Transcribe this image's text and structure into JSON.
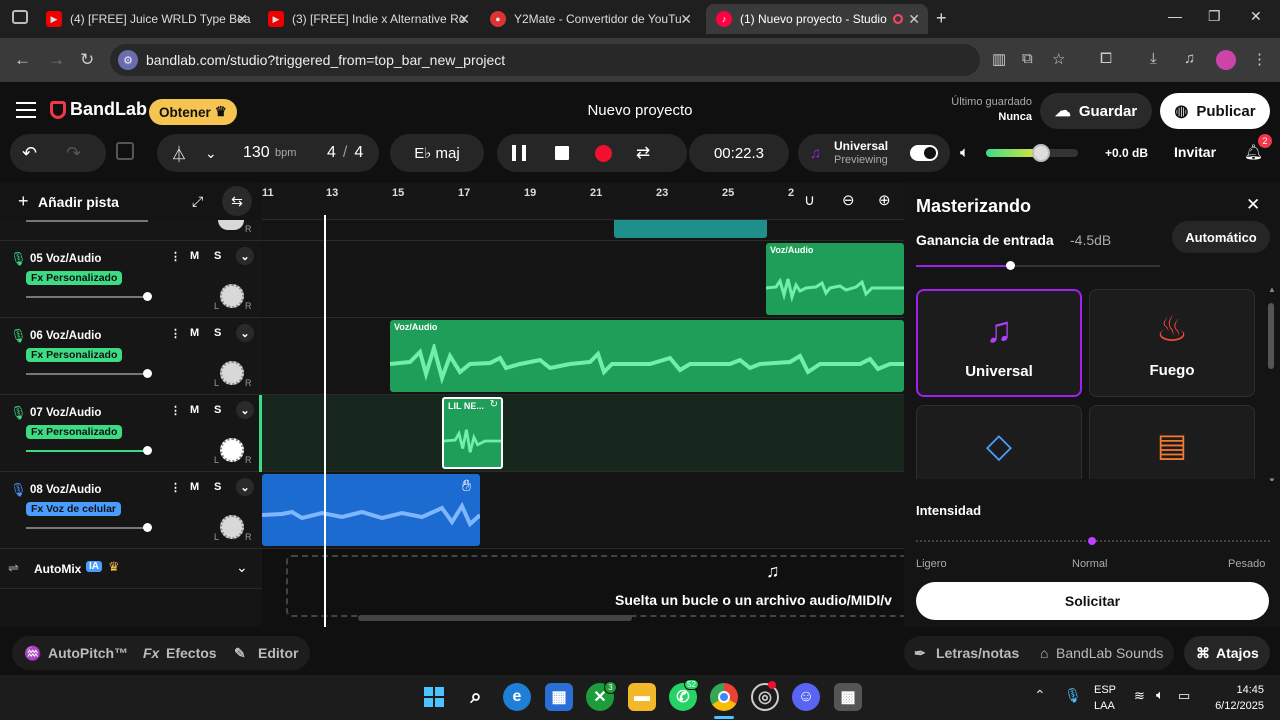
{
  "browser": {
    "tabs": [
      {
        "label": "(4) [FREE] Juice WRLD Type Bea",
        "close": "✕"
      },
      {
        "label": "(3) [FREE] Indie x Alternative Ro",
        "close": "✕"
      },
      {
        "label": "Y2Mate - Convertidor de YouTu",
        "close": "✕"
      },
      {
        "label": "(1) Nuevo proyecto - Studio",
        "close": "✕"
      }
    ],
    "new_tab": "+",
    "url": "bandlab.com/studio?triggered_from=top_bar_new_project"
  },
  "header": {
    "logo": "BandLab",
    "obtener": "Obtener",
    "project_title": "Nuevo proyecto",
    "last_saved_label": "Último guardado",
    "last_saved_value": "Nunca",
    "save": "Guardar",
    "publish": "Publicar"
  },
  "toolbar": {
    "bpm_value": "130",
    "bpm_unit": "bpm",
    "sig_num": "4",
    "sig_sep": "/",
    "sig_den": "4",
    "key": "E♭ maj",
    "time": "00:22.3",
    "universal_title": "Universal",
    "universal_sub": "Previewing",
    "db": "+0.0 dB",
    "invite": "Invitar",
    "notif_count": "2",
    "volume_fraction": 0.6
  },
  "tracks_panel": {
    "add_track": "Añadir pista",
    "ruler": [
      "11",
      "13",
      "15",
      "17",
      "19",
      "21",
      "23",
      "25",
      "2"
    ]
  },
  "tracks": [
    {
      "name": "05 Voz/Audio",
      "fx": "Fx Personalizado",
      "m": "M",
      "s": "S",
      "l": "L",
      "r": "R"
    },
    {
      "name": "06 Voz/Audio",
      "fx": "Fx Personalizado",
      "m": "M",
      "s": "S",
      "l": "L",
      "r": "R"
    },
    {
      "name": "07 Voz/Audio",
      "fx": "Fx Personalizado",
      "m": "M",
      "s": "S",
      "l": "L",
      "r": "R"
    },
    {
      "name": "08 Voz/Audio",
      "fx": "Fx Voz de celular",
      "m": "M",
      "s": "S",
      "l": "L",
      "r": "R"
    }
  ],
  "top_partial": {
    "r": "R"
  },
  "clips": {
    "clip05": "Voz/Audio",
    "clip06": "Voz/Audio",
    "clip07": "LIL NE..."
  },
  "automix": {
    "label": "AutoMix",
    "badge": "IA"
  },
  "drop_zone": "Suelta un bucle o un archivo audio/MIDI/v",
  "master": {
    "title": "Masterizando",
    "gain_label": "Ganancia de entrada",
    "gain_value": "-4.5dB",
    "auto": "Automático",
    "presets": [
      "Universal",
      "Fuego",
      "",
      ""
    ],
    "intensity_title": "Intensidad",
    "intensity_low": "Ligero",
    "intensity_mid": "Normal",
    "intensity_high": "Pesado",
    "apply": "Solicitar"
  },
  "bottom": {
    "autopitch": "AutoPitch™",
    "effects": "Efectos",
    "editor": "Editor",
    "lyrics": "Letras/notas",
    "sounds": "BandLab Sounds",
    "shortcuts": "Atajos"
  },
  "taskbar": {
    "lang1": "ESP",
    "lang2": "LAA",
    "time": "14:45",
    "date": "6/12/2025",
    "badge1": "3",
    "badge2": "52"
  },
  "colors": {
    "accent_green": "#3ddc84",
    "accent_purple": "#a020f0",
    "clip_green": "#1f9e5a",
    "clip_blue": "#1c6bd0",
    "obtener": "#f5c451"
  }
}
